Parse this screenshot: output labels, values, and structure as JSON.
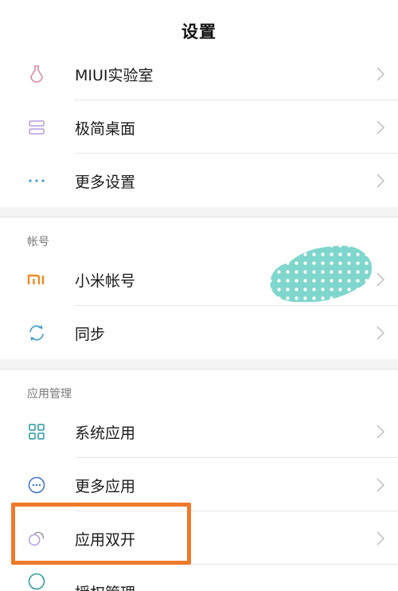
{
  "header": {
    "title": "设置"
  },
  "group1": [
    {
      "label": "MIUI实验室",
      "icon": "flask-icon"
    },
    {
      "label": "极简桌面",
      "icon": "simple-desktop-icon"
    },
    {
      "label": "更多设置",
      "icon": "more-dots-icon"
    }
  ],
  "account": {
    "section_title": "帐号",
    "items": [
      {
        "label": "小米帐号",
        "icon": "mi-logo-icon"
      },
      {
        "label": "同步",
        "icon": "sync-icon"
      }
    ]
  },
  "apps": {
    "section_title": "应用管理",
    "items": [
      {
        "label": "系统应用",
        "icon": "grid-apps-icon"
      },
      {
        "label": "更多应用",
        "icon": "more-circle-icon"
      },
      {
        "label": "应用双开",
        "icon": "dual-app-icon"
      },
      {
        "label": "授权管理",
        "icon": "permission-icon"
      }
    ]
  },
  "colors": {
    "highlight": "#f07a2a",
    "mi_orange": "#f08a24",
    "icon_pink": "#e08aa6",
    "icon_purple": "#b59ce0",
    "icon_blue": "#3a9bd8",
    "icon_teal": "#2a9aa0",
    "blob_teal": "#7fd6cc"
  }
}
